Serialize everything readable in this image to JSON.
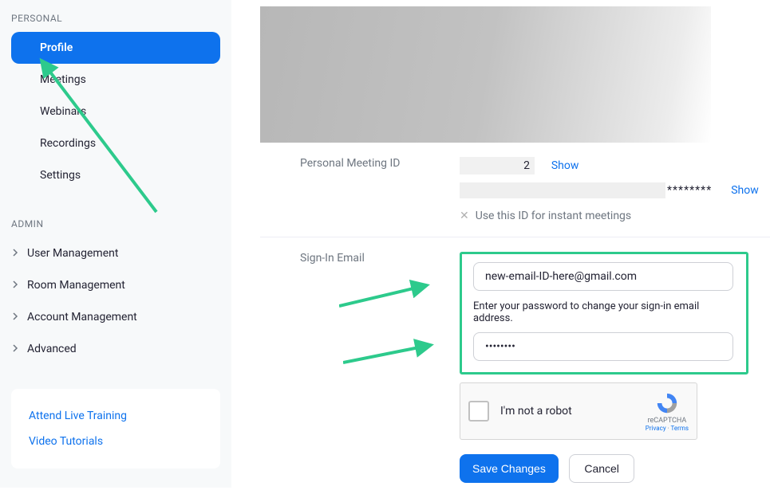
{
  "sidebar": {
    "personal_header": "PERSONAL",
    "items": [
      {
        "label": "Profile"
      },
      {
        "label": "Meetings"
      },
      {
        "label": "Webinars"
      },
      {
        "label": "Recordings"
      },
      {
        "label": "Settings"
      }
    ],
    "admin_header": "ADMIN",
    "admin_items": [
      {
        "label": "User Management"
      },
      {
        "label": "Room Management"
      },
      {
        "label": "Account Management"
      },
      {
        "label": "Advanced"
      }
    ],
    "bottom_links": [
      {
        "label": "Attend Live Training"
      },
      {
        "label": "Video Tutorials"
      }
    ]
  },
  "pmi": {
    "label": "Personal Meeting ID",
    "value_suffix": "2",
    "show": "Show",
    "asterisks": "********",
    "show_right": "Show",
    "instant_text": "Use this ID for instant meetings"
  },
  "signin": {
    "label": "Sign-In Email",
    "email_value": "new-email-ID-here@gmail.com",
    "password_help": "Enter your password to change your sign-in email address.",
    "password_value": "••••••••",
    "recaptcha_text": "I'm not a robot",
    "recaptcha_brand": "reCAPTCHA",
    "recaptcha_privacy": "Privacy",
    "recaptcha_terms": "Terms",
    "save": "Save Changes",
    "cancel": "Cancel"
  },
  "annotation": {
    "arrow_color": "#2dca8c"
  }
}
